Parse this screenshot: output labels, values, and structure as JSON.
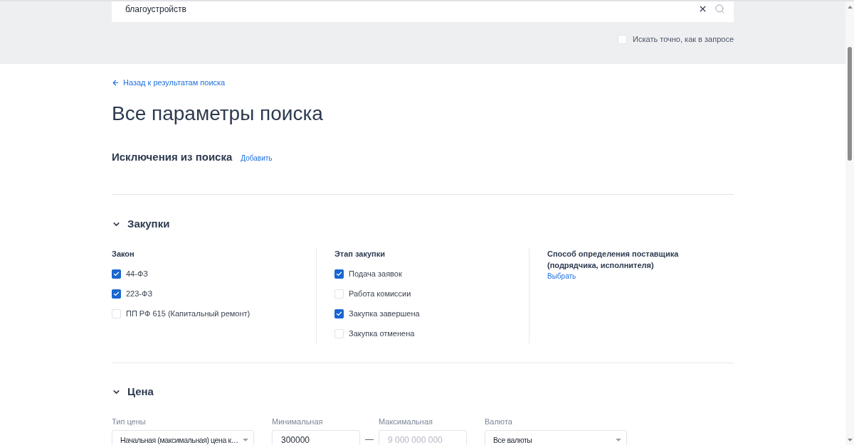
{
  "search": {
    "value": "благоустройств",
    "exact_match": {
      "label": "Искать точно, как в запросе",
      "checked": false
    }
  },
  "back_link": "Назад к результатам поиска",
  "title": "Все параметры поиска",
  "exclusions": {
    "title": "Исключения из поиска",
    "action": "Добавить"
  },
  "procurement": {
    "title": "Закупки",
    "expanded": true,
    "groups": [
      {
        "kind": "checklist",
        "title": "Закон",
        "options": [
          {
            "label": "44-ФЗ",
            "checked": true
          },
          {
            "label": "223-ФЗ",
            "checked": true
          },
          {
            "label": "ПП РФ 615 (Капитальный ремонт)",
            "checked": false
          }
        ]
      },
      {
        "kind": "checklist",
        "title": "Этап закупки",
        "options": [
          {
            "label": "Подача заявок",
            "checked": true
          },
          {
            "label": "Работа комиссии",
            "checked": false
          },
          {
            "label": "Закупка завершена",
            "checked": true
          },
          {
            "label": "Закупка отменена",
            "checked": false
          }
        ]
      },
      {
        "kind": "picker",
        "title": "Способ определения поставщика (подрядчика, исполнителя)",
        "action": "Выбрать"
      }
    ]
  },
  "price": {
    "title": "Цена",
    "expanded": true,
    "fields": [
      {
        "kind": "select",
        "label": "Тип цены",
        "value": "Начальная (максимальная) цена к…"
      },
      {
        "kind": "input",
        "label": "Минимальная",
        "value": "300000"
      },
      {
        "kind": "separator",
        "text": "—"
      },
      {
        "kind": "input",
        "label": "Максимальная",
        "placeholder": "9 000 000 000"
      },
      {
        "kind": "select",
        "label": "Валюта",
        "value": "Все валюты"
      }
    ]
  }
}
